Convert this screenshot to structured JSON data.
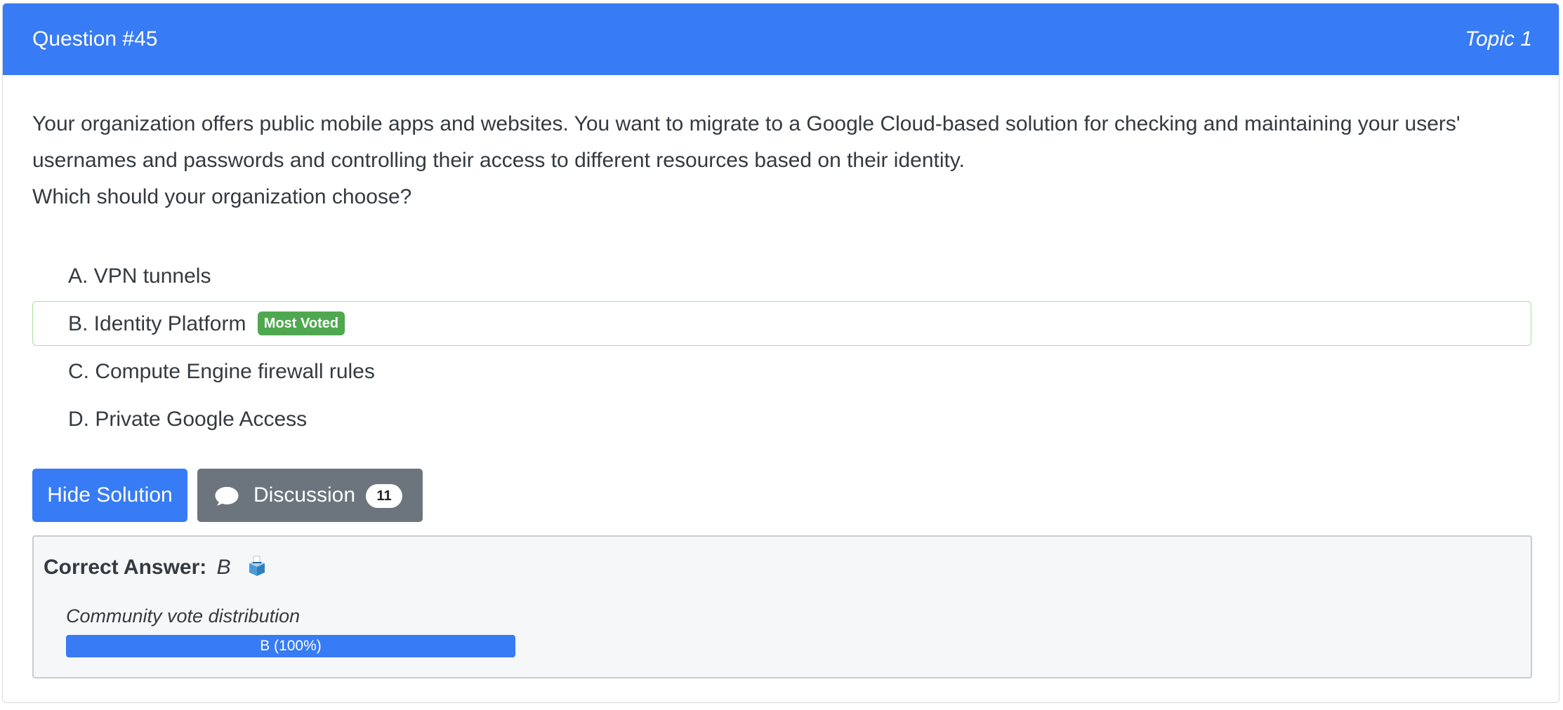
{
  "header": {
    "question_number": "Question #45",
    "topic": "Topic 1"
  },
  "question": {
    "text": "Your organization offers public mobile apps and websites. You want to migrate to a Google Cloud-based solution for checking and maintaining your users' usernames and passwords and controlling their access to different resources based on their identity.",
    "prompt": "Which should your organization choose?"
  },
  "choices": [
    {
      "label": "A. VPN tunnels"
    },
    {
      "label": "B. Identity Platform",
      "badge": "Most Voted"
    },
    {
      "label": "C. Compute Engine firewall rules"
    },
    {
      "label": "D. Private Google Access"
    }
  ],
  "buttons": {
    "hide_solution": "Hide Solution",
    "discussion": "Discussion",
    "discussion_count": "11"
  },
  "answer": {
    "label": "Correct Answer:",
    "value": "B",
    "icon": "ballot-box-icon",
    "vote_distribution_label": "Community vote distribution",
    "vote_bar_text": "B (100%)",
    "vote_share": 1.0
  },
  "colors": {
    "primary": "#377bf5",
    "secondary": "#6c757d",
    "voted_badge": "#4fa84f",
    "voted_border": "#a6e39c"
  }
}
